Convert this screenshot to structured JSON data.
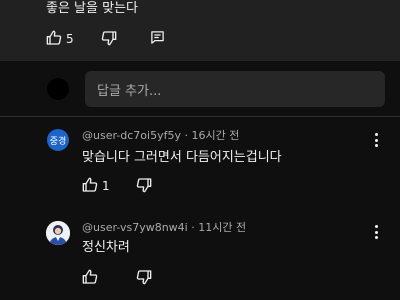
{
  "parent_comment": {
    "text": "좋은 날을 맞는다",
    "like_count": "5",
    "icons": [
      "thumbs-up-icon",
      "thumbs-down-icon",
      "reply-comment-icon"
    ]
  },
  "reply_input": {
    "placeholder": "답글 추가..."
  },
  "replies": [
    {
      "avatar_initials": "중경",
      "avatar_color": "#1c64c8",
      "username": "@user-dc7oi5yf5y",
      "separator": "·",
      "time": "16시간 전",
      "text": "맞습니다 그러면서 다듬어지는겁니다",
      "like_count": "1"
    },
    {
      "username": "@user-vs7yw8nw4i",
      "separator": "·",
      "time": "11시간 전",
      "text": "정신차려",
      "like_count": ""
    }
  ]
}
